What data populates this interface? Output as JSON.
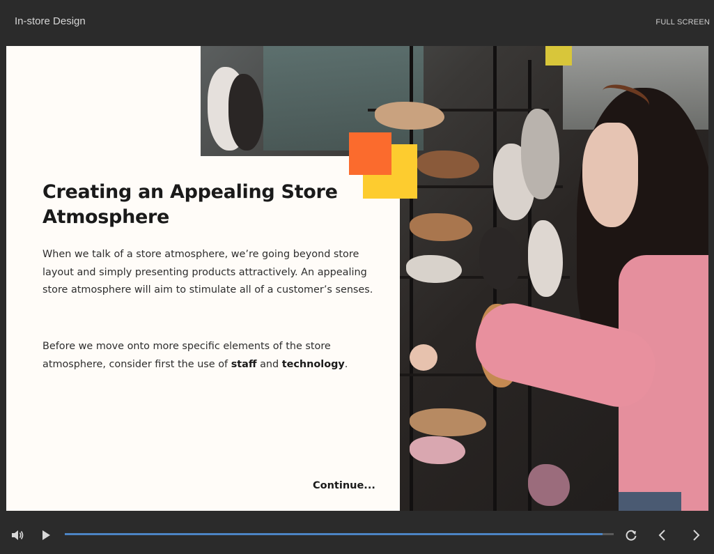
{
  "header": {
    "course_title": "In-store Design",
    "fullscreen_label": "FULL SCREEN"
  },
  "slide": {
    "heading": "Creating an Appealing Store Atmosphere",
    "paragraph1": "When we talk of a store atmosphere, we’re going beyond store layout and simply presenting products attractively. An appealing store atmosphere will aim to stimulate all of a customer’s senses.",
    "paragraph2_before": "Before we move onto more specific elements of the store atmosphere, consider first the use of ",
    "paragraph2_bold1": "staff",
    "paragraph2_mid": " and ",
    "paragraph2_bold2": "technology",
    "paragraph2_after": ".",
    "continue_label": "Continue...",
    "accent_colors": {
      "orange": "#fb6b2d",
      "yellow": "#fdcc2f"
    },
    "image": "photo of woman browsing shoes on store shelves"
  },
  "player": {
    "icons": [
      "volume-icon",
      "play-icon",
      "replay-icon",
      "previous-icon",
      "next-icon"
    ],
    "progress": 0.98,
    "progress_color": "#4c84c4"
  }
}
